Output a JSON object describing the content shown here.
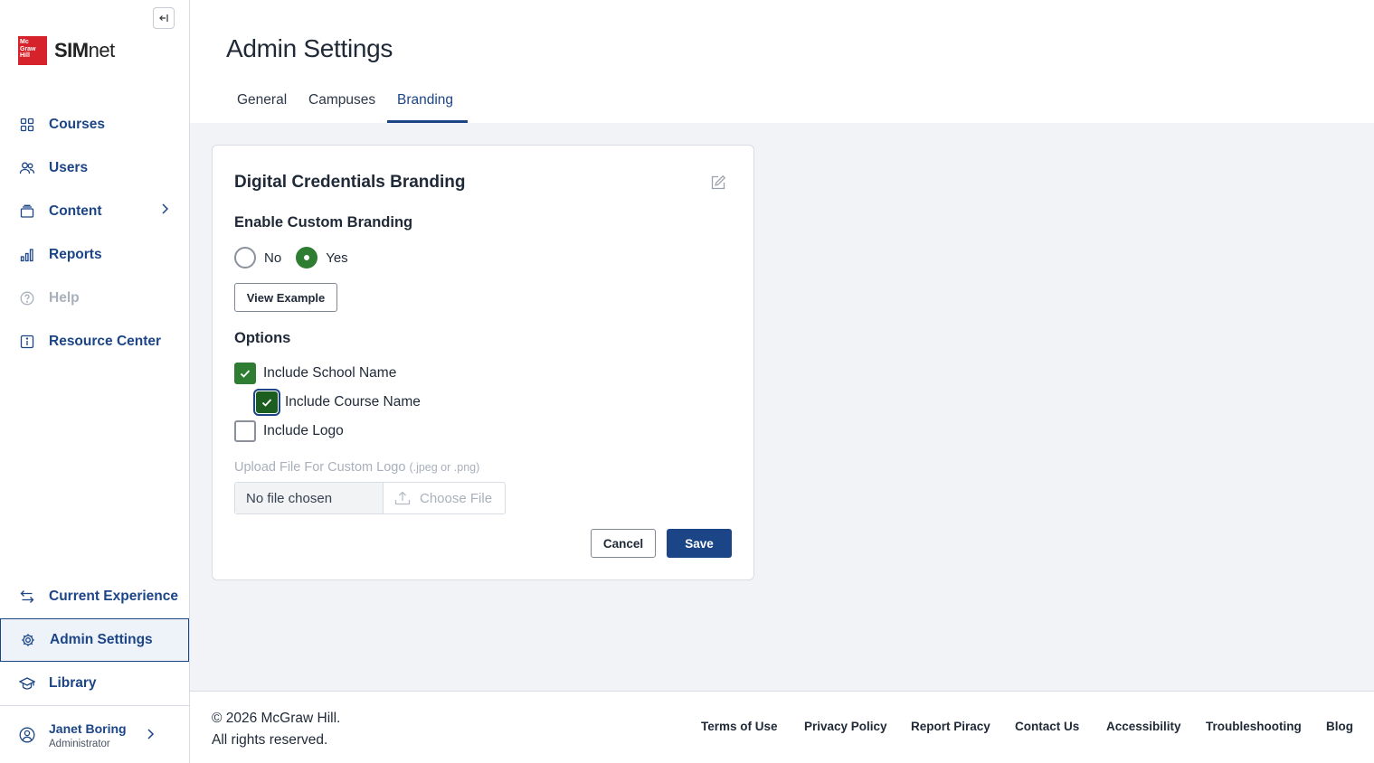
{
  "brand": {
    "logo_box_text": "Mc Graw Hill",
    "logo_sim": "SIM",
    "logo_net": "net",
    "logo_color": "#d6232b"
  },
  "sidebar": {
    "collapse_icon": "collapse-left-icon",
    "items": [
      {
        "label": "Courses",
        "icon": "grid-icon"
      },
      {
        "label": "Users",
        "icon": "users-icon"
      },
      {
        "label": "Content",
        "icon": "content-icon",
        "has_submenu": true
      },
      {
        "label": "Reports",
        "icon": "bar-chart-icon"
      },
      {
        "label": "Help",
        "icon": "help-icon",
        "disabled": true
      },
      {
        "label": "Resource Center",
        "icon": "info-icon"
      }
    ],
    "bottom_items": [
      {
        "label": "Current Experience",
        "icon": "switch-arrows-icon"
      },
      {
        "label": "Admin Settings",
        "icon": "gear-icon",
        "active": true
      },
      {
        "label": "Library",
        "icon": "graduation-cap-icon"
      }
    ],
    "user": {
      "name": "Janet Boring",
      "role": "Administrator",
      "icon": "user-circle-icon"
    }
  },
  "header": {
    "title": "Admin Settings",
    "tabs": [
      {
        "label": "General"
      },
      {
        "label": "Campuses"
      },
      {
        "label": "Branding",
        "active": true
      }
    ]
  },
  "card": {
    "title": "Digital Credentials Branding",
    "edit_icon": "pencil-square-icon",
    "enable_title": "Enable Custom Branding",
    "radio_no": "No",
    "radio_yes": "Yes",
    "selected": "Yes",
    "view_example": "View Example",
    "options_title": "Options",
    "options": [
      {
        "label": "Include School Name",
        "checked": true
      },
      {
        "label": "Include Course Name",
        "checked": true,
        "focused": true
      },
      {
        "label": "Include Logo",
        "checked": false
      }
    ],
    "upload_label": "Upload File For Custom Logo",
    "upload_hint": "(.jpeg or .png)",
    "file_name": "No file chosen",
    "choose_file": "Choose File",
    "cancel": "Cancel",
    "save": "Save"
  },
  "footer": {
    "copyright_line1": "© 2026 McGraw Hill.",
    "copyright_line2": "All rights reserved.",
    "links": [
      "Terms of Use",
      "Privacy Policy",
      "Report Piracy",
      "Contact Us",
      "Accessibility",
      "Troubleshooting",
      "Blog"
    ]
  },
  "colors": {
    "primary": "#1c4587",
    "success": "#2e7d32",
    "content_bg": "#f1f3f7"
  }
}
